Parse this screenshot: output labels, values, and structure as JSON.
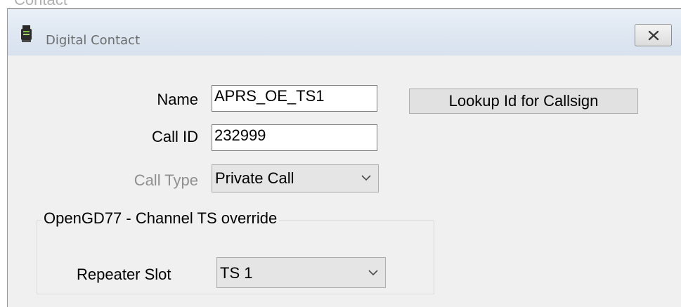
{
  "window": {
    "title": "Digital Contact",
    "close_icon": "close-icon",
    "app_icon": "radio-handset-icon"
  },
  "form": {
    "name_label": "Name",
    "name_value": "APRS_OE_TS1",
    "call_id_label": "Call ID",
    "call_id_value": "232999",
    "call_type_label": "Call Type",
    "call_type_value": "Private Call",
    "lookup_button": "Lookup Id for Callsign"
  },
  "ts_override": {
    "group_title": "OpenGD77 - Channel TS override",
    "repeater_slot_label": "Repeater Slot",
    "repeater_slot_value": "TS 1"
  },
  "colors": {
    "titlebar": "#dde6f1",
    "client_background": "#f0f0f0",
    "disabled_text": "#8f8f8f"
  }
}
